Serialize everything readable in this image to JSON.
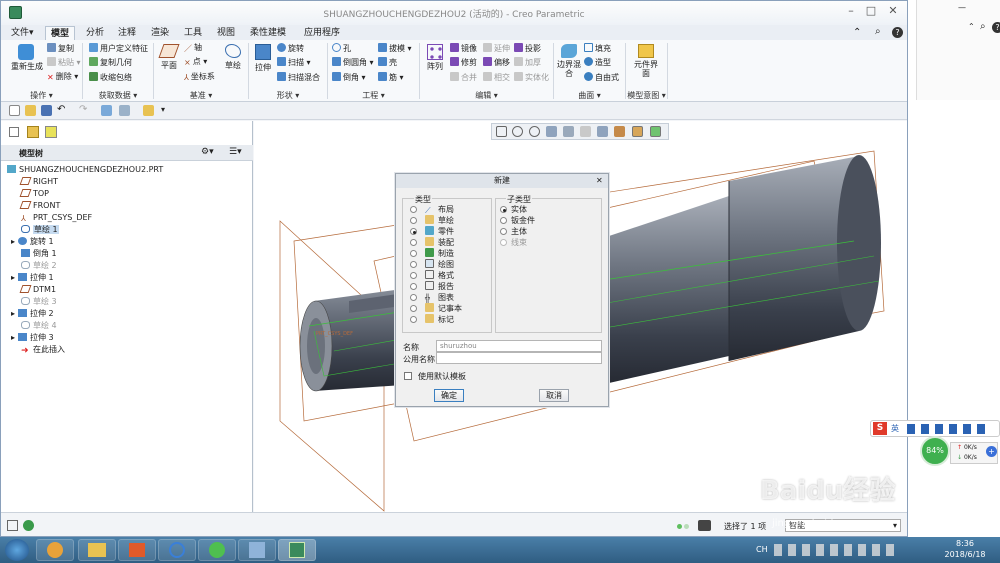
{
  "window": {
    "title": "SHUANGZHOUCHENGDEZHOU2 (活动的) - Creo Parametric",
    "min": "–",
    "max": "□",
    "close": "✕"
  },
  "tabs": [
    "文件▾",
    "模型",
    "分析",
    "注释",
    "渲染",
    "工具",
    "视图",
    "柔性建模",
    "应用程序"
  ],
  "ribbon": {
    "ops": {
      "regen": "重新生成",
      "copy": "复制",
      "paste": "粘贴",
      "delete": "删除"
    },
    "getdata": {
      "udf": "用户定义特征",
      "copygeom": "复制几何",
      "shrink": "收缩包络"
    },
    "datum": {
      "plane": "平面",
      "axis": "轴",
      "point": "点",
      "csys": "坐标系",
      "sketch": "草绘"
    },
    "shapes": {
      "extrude": "拉伸",
      "revolve": "旋转",
      "sweep": "扫描",
      "swblend": "扫描混合"
    },
    "eng": {
      "hole": "孔",
      "draft": "拔模",
      "round": "倒圆角",
      "shell": "壳",
      "chamfer": "倒角",
      "rib": "筋"
    },
    "edit": {
      "pattern": "阵列",
      "mirror": "镜像",
      "extend": "延伸",
      "project": "投影",
      "trim": "修剪",
      "offset": "偏移",
      "thicken": "加厚",
      "merge": "合并",
      "intersect": "相交",
      "solidify": "实体化"
    },
    "surface": {
      "boundary": "边界混合",
      "fill": "填充",
      "style": "造型",
      "freestyle": "自由式"
    },
    "intent": {
      "component": "元件界面"
    },
    "groups": [
      "操作 ▾",
      "获取数据 ▾",
      "基准 ▾",
      "形状 ▾",
      "工程 ▾",
      "编辑 ▾",
      "曲面 ▾",
      "模型意图 ▾"
    ]
  },
  "tree": {
    "header": "模型树",
    "items": [
      {
        "label": "SHUANGZHOUCHENGDEZHOU2.PRT",
        "state": "normal"
      },
      {
        "label": "RIGHT",
        "state": "normal"
      },
      {
        "label": "TOP",
        "state": "normal"
      },
      {
        "label": "FRONT",
        "state": "normal"
      },
      {
        "label": "PRT_CSYS_DEF",
        "state": "normal"
      },
      {
        "label": "草绘 1",
        "state": "selected"
      },
      {
        "label": "旋转 1",
        "state": "normal"
      },
      {
        "label": "倒角 1",
        "state": "normal"
      },
      {
        "label": "草绘 2",
        "state": "grey"
      },
      {
        "label": "拉伸 1",
        "state": "normal"
      },
      {
        "label": "DTM1",
        "state": "normal"
      },
      {
        "label": "草绘 3",
        "state": "grey"
      },
      {
        "label": "拉伸 2",
        "state": "normal"
      },
      {
        "label": "草绘 4",
        "state": "grey"
      },
      {
        "label": "拉伸 3",
        "state": "normal"
      },
      {
        "label": "在此插入",
        "state": "normal"
      }
    ]
  },
  "canvas": {
    "csys_label": "PRT_CSYS_DEF"
  },
  "dialog": {
    "title": "新建",
    "close": "✕",
    "type_label": "类型",
    "subtype_label": "子类型",
    "types": [
      "布局",
      "草绘",
      "零件",
      "装配",
      "制造",
      "绘图",
      "格式",
      "报告",
      "图表",
      "记事本",
      "标记"
    ],
    "selected_type": "零件",
    "subtypes": [
      "实体",
      "钣金件",
      "主体",
      "线束"
    ],
    "selected_subtype": "实体",
    "name_label": "名称",
    "name_value": "shuruzhou",
    "common_name_label": "公用名称",
    "common_name_value": "",
    "template_label": "使用默认模板",
    "ok": "确定",
    "cancel": "取消"
  },
  "statusbar": {
    "selection": "选择了 1 项",
    "filter": "智能"
  },
  "rightpanel": {
    "ime_label": "英",
    "speed_pct": "84%",
    "up": "0K/s",
    "down": "0K/s"
  },
  "watermark": "Baidu经验",
  "watermark_url": "jingyan.baidu.com",
  "taskbar": {
    "time": "8:36",
    "date": "2018/6/18",
    "lang": "CH"
  },
  "colors": {
    "accent": "#2f6fb0",
    "model_dark": "#2e3440",
    "model_light": "#9ea4ad",
    "datum": "#b56a3a",
    "sketch_green": "#3bbf3b"
  }
}
